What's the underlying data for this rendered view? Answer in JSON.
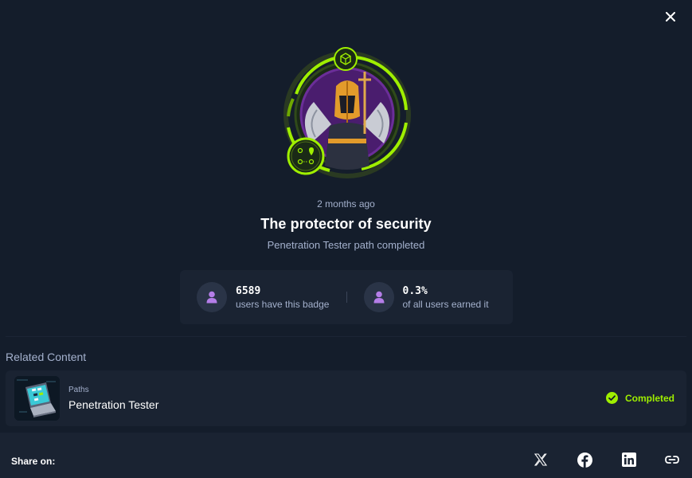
{
  "modal": {
    "close_icon": "close-icon"
  },
  "badge": {
    "image_icon": "knight-badge-emblem",
    "earned_ago": "2 months ago",
    "title": "The protector of security",
    "subtitle": "Penetration Tester path completed",
    "accent_color": "#9fef00",
    "ring_color": "#3c4d1f"
  },
  "stats": [
    {
      "icon": "user-icon",
      "value": "6589",
      "label": "users have this badge"
    },
    {
      "icon": "user-icon",
      "value": "0.3%",
      "label": "of all users earned it"
    }
  ],
  "related": {
    "heading": "Related Content",
    "items": [
      {
        "type": "Paths",
        "name": "Penetration Tester",
        "status": "Completed",
        "status_icon": "check-circle-icon",
        "thumb_icon": "laptop-terminal-icon"
      }
    ]
  },
  "share": {
    "label": "Share on:",
    "targets": [
      {
        "name": "x-icon"
      },
      {
        "name": "facebook-icon"
      },
      {
        "name": "linkedin-icon"
      },
      {
        "name": "link-icon"
      }
    ]
  },
  "colors": {
    "background": "#141d2b",
    "card": "#1a2332",
    "muted_text": "#a4b1cd",
    "success": "#9fef00",
    "stat_icon": "#9f6cdb"
  }
}
